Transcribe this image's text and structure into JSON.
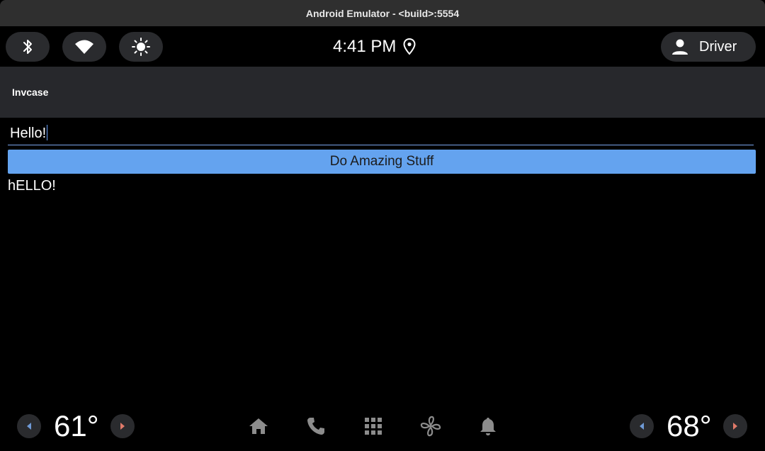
{
  "window": {
    "title": "Android Emulator - <build>:5554"
  },
  "statusbar": {
    "quick_controls": [
      {
        "icon": "bluetooth-icon"
      },
      {
        "icon": "wifi-icon"
      },
      {
        "icon": "brightness-icon"
      }
    ],
    "time": "4:41 PM",
    "location_icon": "location-pin-icon",
    "user": {
      "icon": "person-icon",
      "label": "Driver"
    }
  },
  "appbar": {
    "title": "Invcase"
  },
  "main": {
    "input_value": "Hello!",
    "button_label": "Do Amazing Stuff",
    "output_text": "hELLO!"
  },
  "hvac": {
    "left_temp": "61°",
    "right_temp": "68°"
  },
  "nav": {
    "icons": [
      "home-icon",
      "phone-icon",
      "apps-grid-icon",
      "fan-icon",
      "bell-icon"
    ]
  },
  "colors": {
    "accent": "#64a3ef",
    "arrow_left": "#6f9ad6",
    "arrow_right": "#e07a6a",
    "nav_icon": "#8c8c8c"
  }
}
